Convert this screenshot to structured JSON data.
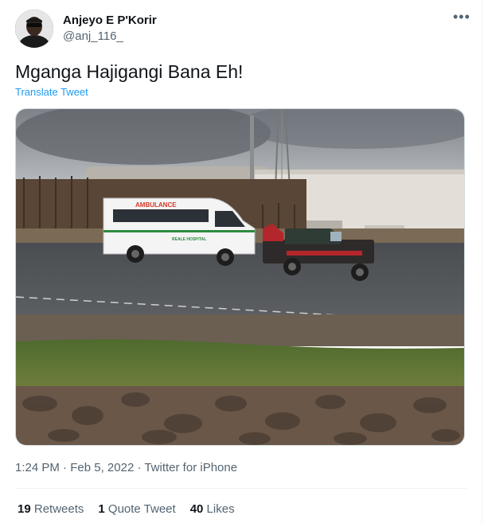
{
  "author": {
    "display_name": "Anjeyo E P'Korir",
    "handle": "@anj_116_"
  },
  "tweet": {
    "text": "Mganga Hajigangi Bana Eh!",
    "translate_label": "Translate Tweet"
  },
  "photo": {
    "ambulance_text": "AMBULANCE",
    "hospital_text": "REALE HOSPITAL"
  },
  "meta": {
    "time": "1:24 PM",
    "sep1": " · ",
    "date": "Feb 5, 2022",
    "sep2": " · ",
    "source": "Twitter for iPhone"
  },
  "stats": {
    "retweets_count": "19",
    "retweets_label": "Retweets",
    "quotes_count": "1",
    "quotes_label": "Quote Tweet",
    "likes_count": "40",
    "likes_label": "Likes"
  },
  "icons": {
    "more": "more-options-icon"
  }
}
